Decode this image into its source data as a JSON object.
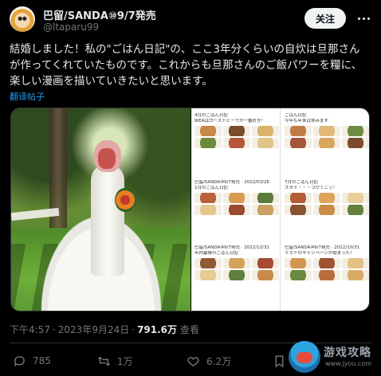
{
  "author": {
    "name": "巴留/SANDA⑩9/7発売",
    "handle": "@ltaparu99",
    "follow_label": "关注"
  },
  "tweet": {
    "lines": [
      "結婚しました！私の\"ごはん日記\"の、ここ3年分くらいの自炊は旦那さん",
      "が作ってくれていたものです。これからも旦那さんのご飯パワーを糧に、",
      "楽しい漫画を描いていきたいと思います。"
    ],
    "translate_label": "翻译帖子"
  },
  "comic": {
    "left_entries": [
      {
        "caption": "4月のごはん日記",
        "caption2": "IKEAはローストビーフが一番好き！",
        "colors": [
          "#c9874a",
          "#7a4b2c",
          "#d9b26b",
          "#6d8a3a",
          "#b5553a",
          "#e0c48a"
        ]
      },
      {
        "caption": "巴留/SANDA⑩9/7発売 · 2022/03/26",
        "caption2": "1月のごはん日記",
        "colors": [
          "#b8623c",
          "#d79b52",
          "#5d7a3a",
          "#e5c78e",
          "#9b4a2f",
          "#caa063"
        ]
      },
      {
        "caption": "巴留/SANDA⑩9/7発売 · 2022/12/31",
        "caption2": "年内最後のごはん日記",
        "colors": [
          "#8f5a34",
          "#d4a25c",
          "#a84a34",
          "#e6ca92",
          "#5f7f3c",
          "#c88a4a"
        ]
      }
    ],
    "right_entries": [
      {
        "caption": "ごはん日記",
        "caption2": "今年も年末は休みます",
        "colors": [
          "#c07c45",
          "#e2b979",
          "#6f8c44",
          "#a6543a",
          "#d8a65e",
          "#7c4a2c"
        ]
      },
      {
        "caption": "7月のごはん日記",
        "caption2": "スタミ・・・つけてこッ！",
        "colors": [
          "#b35c36",
          "#dca55a",
          "#e9cf9a",
          "#8a5230",
          "#c98d48",
          "#63813c"
        ]
      },
      {
        "caption": "巴留/SANDA⑩9/7発売 · 2022/10/31",
        "caption2": "ミスドのキャンペーンが始まった！",
        "colors": [
          "#d1964f",
          "#9c5334",
          "#e4c185",
          "#6a8a40",
          "#bb6c3e",
          "#d9ac66"
        ]
      }
    ]
  },
  "meta": {
    "time": "下午4:57",
    "date": "2023年9月24日",
    "views": "791.6万",
    "views_label": "查看"
  },
  "actions": {
    "replies": "785",
    "reposts": "1万",
    "likes": "6.2万"
  },
  "watermark": {
    "text": "游戏攻略",
    "sub": "www.jyou.com"
  }
}
